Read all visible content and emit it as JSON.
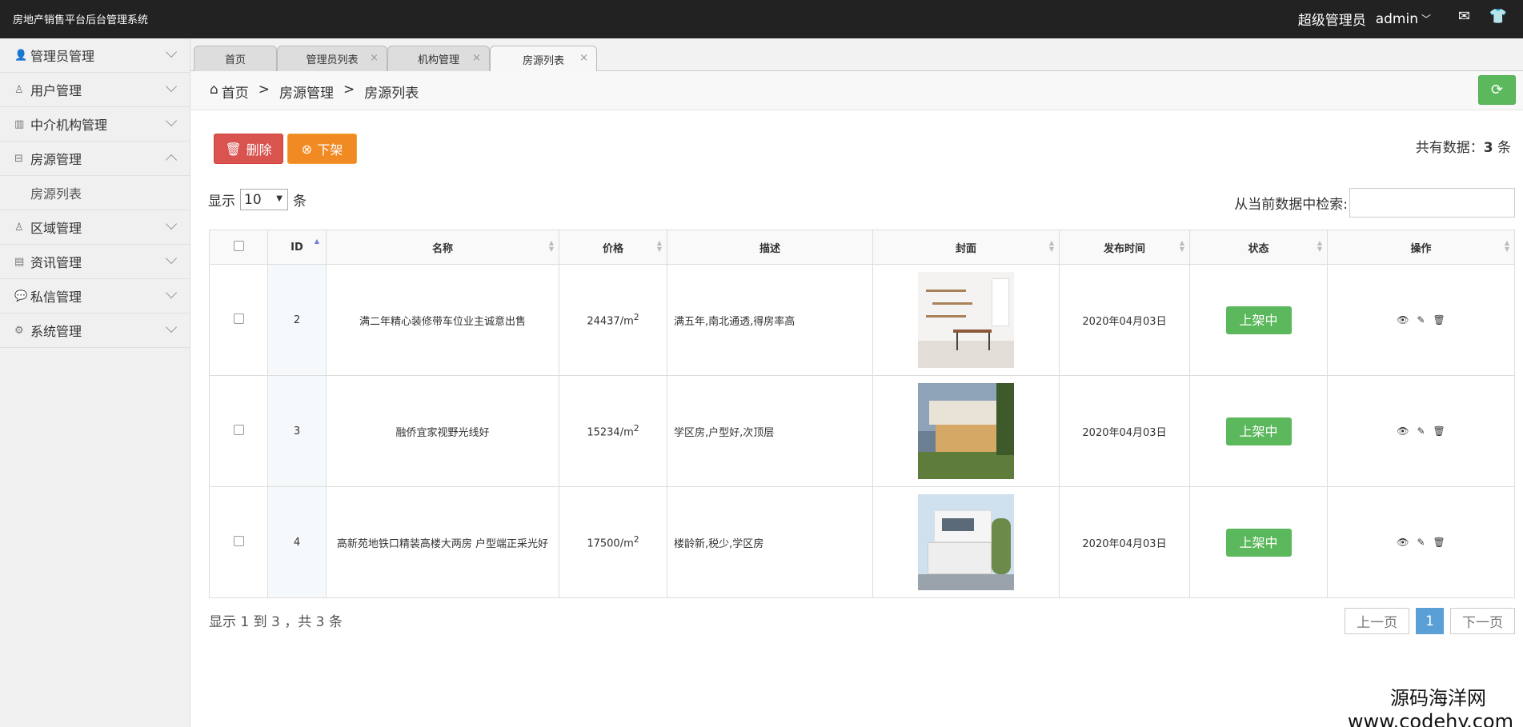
{
  "app": {
    "title": "房地产销售平台后台管理系统"
  },
  "topbar": {
    "role": "超级管理员",
    "username": "admin"
  },
  "sidebar": {
    "items": [
      {
        "label": "管理员管理",
        "icon": "user-icon",
        "expanded": false
      },
      {
        "label": "用户管理",
        "icon": "person-icon",
        "expanded": false
      },
      {
        "label": "中介机构管理",
        "icon": "building-icon",
        "expanded": false
      },
      {
        "label": "房源管理",
        "icon": "briefcase-icon",
        "expanded": true
      },
      {
        "label": "区域管理",
        "icon": "person-icon",
        "expanded": false
      },
      {
        "label": "资讯管理",
        "icon": "news-icon",
        "expanded": false
      },
      {
        "label": "私信管理",
        "icon": "chat-icon",
        "expanded": false
      },
      {
        "label": "系统管理",
        "icon": "gear-icon",
        "expanded": false
      }
    ],
    "subitem": "房源列表"
  },
  "tabs": [
    {
      "label": "首页",
      "closable": false
    },
    {
      "label": "管理员列表",
      "closable": true
    },
    {
      "label": "机构管理",
      "closable": true
    },
    {
      "label": "房源列表",
      "closable": true,
      "active": true
    }
  ],
  "breadcrumb": {
    "home": "首页",
    "sep": ">",
    "level1": "房源管理",
    "level2": "房源列表"
  },
  "toolbar": {
    "delete_label": "删除",
    "offshelf_label": "下架",
    "total_prefix": "共有数据：",
    "total_count": "3",
    "total_suffix": "条"
  },
  "table_ctl": {
    "show_prefix": "显示",
    "page_size": "10",
    "show_suffix": "条",
    "search_label": "从当前数据中检索:"
  },
  "table": {
    "columns": [
      "ID",
      "名称",
      "价格",
      "描述",
      "封面",
      "发布时间",
      "状态",
      "操作"
    ],
    "rows": [
      {
        "id": "2",
        "name": "满二年精心装修带车位业主诚意出售",
        "price": "24437/m",
        "desc": "满五年,南北通透,得房率高",
        "date": "2020年04月03日",
        "status": "上架中"
      },
      {
        "id": "3",
        "name": "融侨宜家视野光线好",
        "price": "15234/m",
        "desc": "学区房,户型好,次顶层",
        "date": "2020年04月03日",
        "status": "上架中"
      },
      {
        "id": "4",
        "name": "高新苑地铁口精装高楼大两房 户型端正采光好",
        "price": "17500/m",
        "desc": "楼龄新,税少,学区房",
        "date": "2020年04月03日",
        "status": "上架中"
      }
    ],
    "price_sup": "2"
  },
  "footer": {
    "info": "显示 1 到 3 ，共 3 条",
    "prev": "上一页",
    "page": "1",
    "next": "下一页"
  },
  "watermark": {
    "line1": "源码海洋网",
    "line2": "www.codehy.com"
  }
}
